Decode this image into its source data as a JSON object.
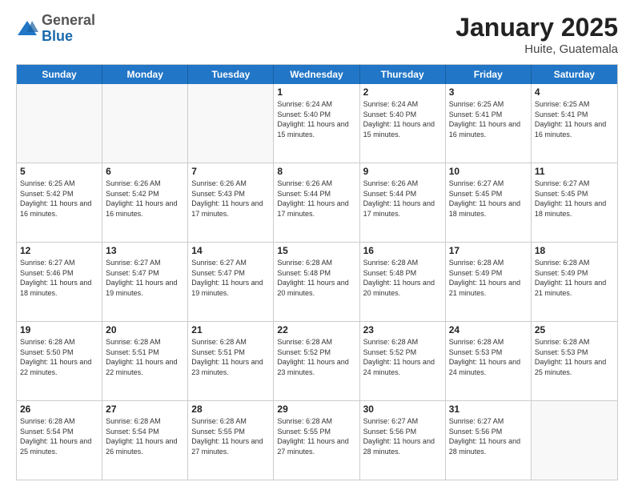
{
  "header": {
    "logo_general": "General",
    "logo_blue": "Blue",
    "month_year": "January 2025",
    "location": "Huite, Guatemala"
  },
  "days_of_week": [
    "Sunday",
    "Monday",
    "Tuesday",
    "Wednesday",
    "Thursday",
    "Friday",
    "Saturday"
  ],
  "weeks": [
    [
      {
        "day": "",
        "info": ""
      },
      {
        "day": "",
        "info": ""
      },
      {
        "day": "",
        "info": ""
      },
      {
        "day": "1",
        "info": "Sunrise: 6:24 AM\nSunset: 5:40 PM\nDaylight: 11 hours and 15 minutes."
      },
      {
        "day": "2",
        "info": "Sunrise: 6:24 AM\nSunset: 5:40 PM\nDaylight: 11 hours and 15 minutes."
      },
      {
        "day": "3",
        "info": "Sunrise: 6:25 AM\nSunset: 5:41 PM\nDaylight: 11 hours and 16 minutes."
      },
      {
        "day": "4",
        "info": "Sunrise: 6:25 AM\nSunset: 5:41 PM\nDaylight: 11 hours and 16 minutes."
      }
    ],
    [
      {
        "day": "5",
        "info": "Sunrise: 6:25 AM\nSunset: 5:42 PM\nDaylight: 11 hours and 16 minutes."
      },
      {
        "day": "6",
        "info": "Sunrise: 6:26 AM\nSunset: 5:42 PM\nDaylight: 11 hours and 16 minutes."
      },
      {
        "day": "7",
        "info": "Sunrise: 6:26 AM\nSunset: 5:43 PM\nDaylight: 11 hours and 17 minutes."
      },
      {
        "day": "8",
        "info": "Sunrise: 6:26 AM\nSunset: 5:44 PM\nDaylight: 11 hours and 17 minutes."
      },
      {
        "day": "9",
        "info": "Sunrise: 6:26 AM\nSunset: 5:44 PM\nDaylight: 11 hours and 17 minutes."
      },
      {
        "day": "10",
        "info": "Sunrise: 6:27 AM\nSunset: 5:45 PM\nDaylight: 11 hours and 18 minutes."
      },
      {
        "day": "11",
        "info": "Sunrise: 6:27 AM\nSunset: 5:45 PM\nDaylight: 11 hours and 18 minutes."
      }
    ],
    [
      {
        "day": "12",
        "info": "Sunrise: 6:27 AM\nSunset: 5:46 PM\nDaylight: 11 hours and 18 minutes."
      },
      {
        "day": "13",
        "info": "Sunrise: 6:27 AM\nSunset: 5:47 PM\nDaylight: 11 hours and 19 minutes."
      },
      {
        "day": "14",
        "info": "Sunrise: 6:27 AM\nSunset: 5:47 PM\nDaylight: 11 hours and 19 minutes."
      },
      {
        "day": "15",
        "info": "Sunrise: 6:28 AM\nSunset: 5:48 PM\nDaylight: 11 hours and 20 minutes."
      },
      {
        "day": "16",
        "info": "Sunrise: 6:28 AM\nSunset: 5:48 PM\nDaylight: 11 hours and 20 minutes."
      },
      {
        "day": "17",
        "info": "Sunrise: 6:28 AM\nSunset: 5:49 PM\nDaylight: 11 hours and 21 minutes."
      },
      {
        "day": "18",
        "info": "Sunrise: 6:28 AM\nSunset: 5:49 PM\nDaylight: 11 hours and 21 minutes."
      }
    ],
    [
      {
        "day": "19",
        "info": "Sunrise: 6:28 AM\nSunset: 5:50 PM\nDaylight: 11 hours and 22 minutes."
      },
      {
        "day": "20",
        "info": "Sunrise: 6:28 AM\nSunset: 5:51 PM\nDaylight: 11 hours and 22 minutes."
      },
      {
        "day": "21",
        "info": "Sunrise: 6:28 AM\nSunset: 5:51 PM\nDaylight: 11 hours and 23 minutes."
      },
      {
        "day": "22",
        "info": "Sunrise: 6:28 AM\nSunset: 5:52 PM\nDaylight: 11 hours and 23 minutes."
      },
      {
        "day": "23",
        "info": "Sunrise: 6:28 AM\nSunset: 5:52 PM\nDaylight: 11 hours and 24 minutes."
      },
      {
        "day": "24",
        "info": "Sunrise: 6:28 AM\nSunset: 5:53 PM\nDaylight: 11 hours and 24 minutes."
      },
      {
        "day": "25",
        "info": "Sunrise: 6:28 AM\nSunset: 5:53 PM\nDaylight: 11 hours and 25 minutes."
      }
    ],
    [
      {
        "day": "26",
        "info": "Sunrise: 6:28 AM\nSunset: 5:54 PM\nDaylight: 11 hours and 25 minutes."
      },
      {
        "day": "27",
        "info": "Sunrise: 6:28 AM\nSunset: 5:54 PM\nDaylight: 11 hours and 26 minutes."
      },
      {
        "day": "28",
        "info": "Sunrise: 6:28 AM\nSunset: 5:55 PM\nDaylight: 11 hours and 27 minutes."
      },
      {
        "day": "29",
        "info": "Sunrise: 6:28 AM\nSunset: 5:55 PM\nDaylight: 11 hours and 27 minutes."
      },
      {
        "day": "30",
        "info": "Sunrise: 6:27 AM\nSunset: 5:56 PM\nDaylight: 11 hours and 28 minutes."
      },
      {
        "day": "31",
        "info": "Sunrise: 6:27 AM\nSunset: 5:56 PM\nDaylight: 11 hours and 28 minutes."
      },
      {
        "day": "",
        "info": ""
      }
    ]
  ]
}
